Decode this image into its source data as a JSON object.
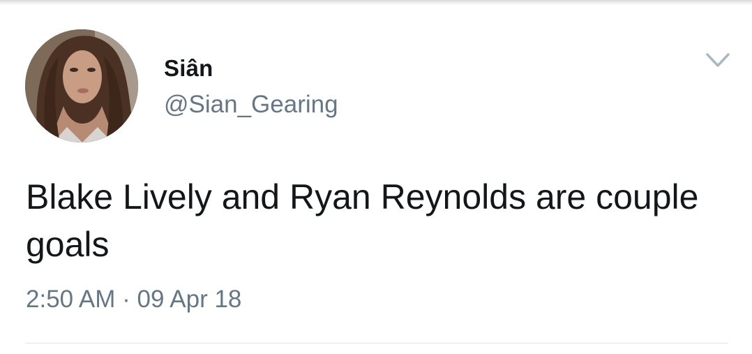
{
  "user": {
    "display_name": "Siân",
    "handle": "@Sian_Gearing"
  },
  "tweet": {
    "text": "Blake Lively and Ryan Reynolds are couple goals",
    "time": "2:50 AM",
    "separator": "·",
    "date": "09 Apr 18"
  },
  "icons": {
    "menu": "chevron-down-icon",
    "avatar": "profile-photo"
  },
  "colors": {
    "name": "#14171a",
    "secondary": "#657786",
    "chevron": "#aab8c2",
    "divider": "#e1e8ed"
  }
}
